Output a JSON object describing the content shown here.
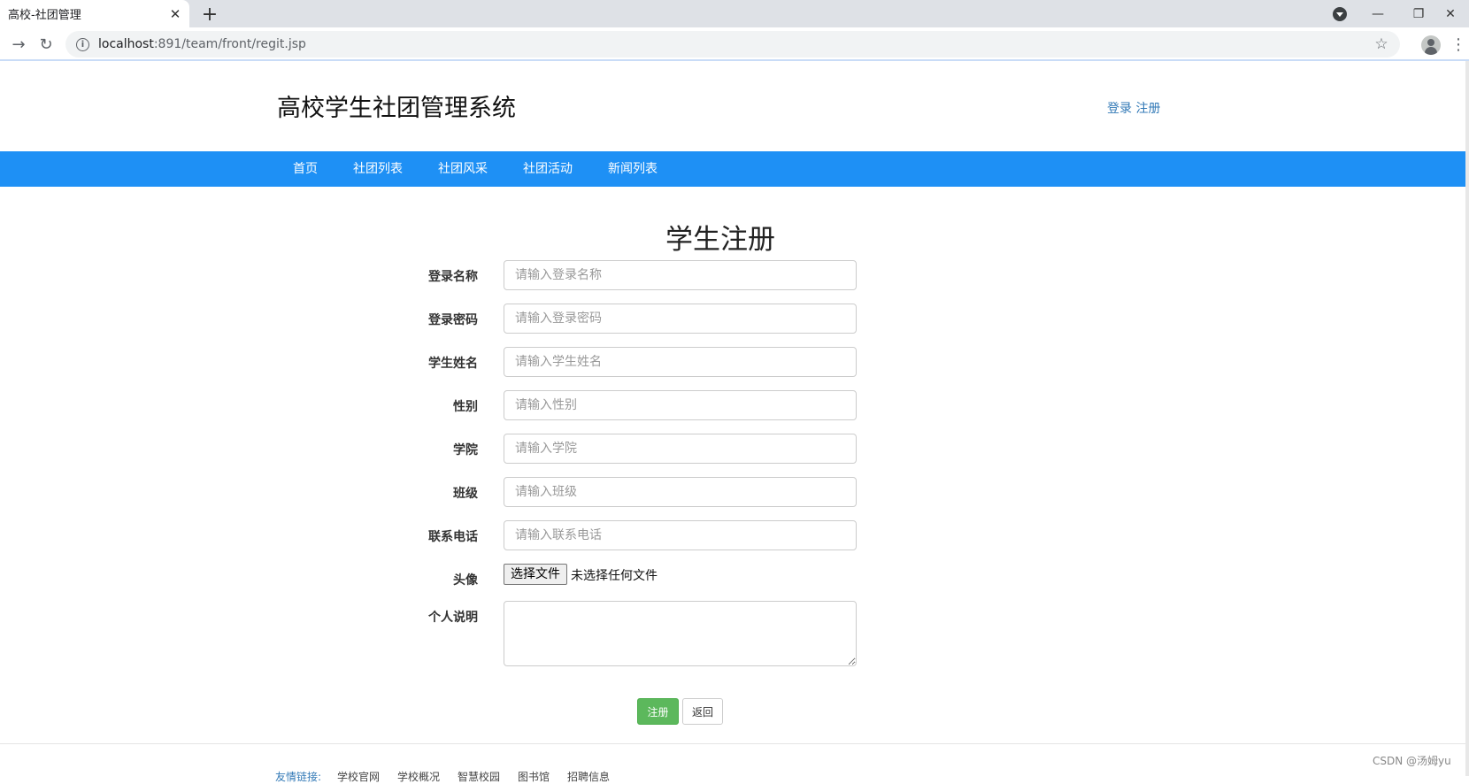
{
  "browser": {
    "tab_title": "高校-社团管理",
    "tab_close": "✕",
    "new_tab": "+",
    "url_host": "localhost",
    "url_path": ":891/team/front/regit.jsp",
    "info": "i",
    "back": "→",
    "reload": "↻",
    "star": "☆",
    "menu": "⋮",
    "minimize": "—",
    "restore": "❐",
    "close": "✕"
  },
  "header": {
    "site_title": "高校学生社团管理系统",
    "login": "登录",
    "register": "注册"
  },
  "nav": [
    "首页",
    "社团列表",
    "社团风采",
    "社团活动",
    "新闻列表"
  ],
  "form": {
    "title": "学生注册",
    "fields": [
      {
        "label": "登录名称",
        "placeholder": "请输入登录名称"
      },
      {
        "label": "登录密码",
        "placeholder": "请输入登录密码"
      },
      {
        "label": "学生姓名",
        "placeholder": "请输入学生姓名"
      },
      {
        "label": "性别",
        "placeholder": "请输入性别"
      },
      {
        "label": "学院",
        "placeholder": "请输入学院"
      },
      {
        "label": "班级",
        "placeholder": "请输入班级"
      },
      {
        "label": "联系电话",
        "placeholder": "请输入联系电话"
      }
    ],
    "avatar_label": "头像",
    "file_button": "选择文件",
    "file_status": "未选择任何文件",
    "bio_label": "个人说明",
    "submit": "注册",
    "back": "返回"
  },
  "footer": {
    "links": [
      "友情链接:",
      "学校官网",
      "学校概况",
      "智慧校园",
      "图书馆",
      "招聘信息"
    ],
    "watermark": "CSDN @汤姆yu"
  }
}
